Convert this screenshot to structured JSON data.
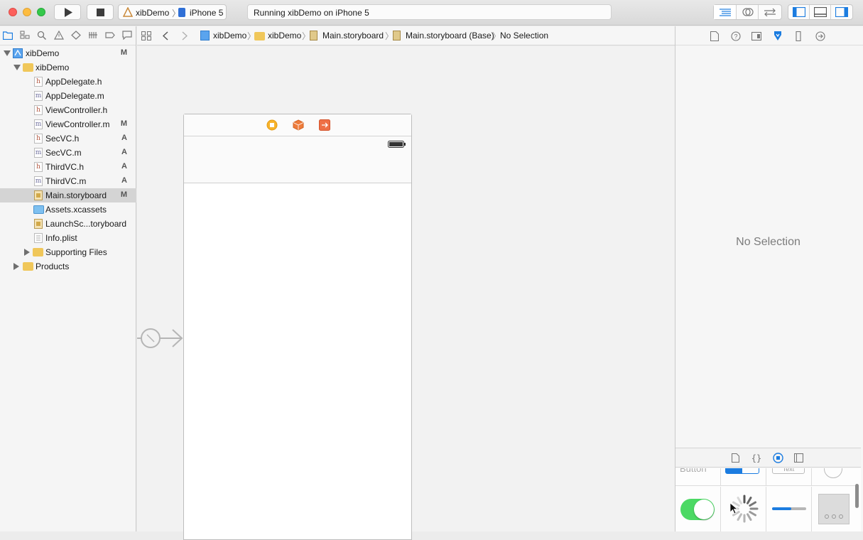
{
  "toolbar": {
    "scheme_project": "xibDemo",
    "scheme_device": "iPhone 5",
    "status_text": "Running xibDemo on iPhone 5"
  },
  "navigator": {
    "items": [
      {
        "label": "xibDemo",
        "badge": "M",
        "kind": "project"
      },
      {
        "label": "xibDemo",
        "badge": "",
        "kind": "folder"
      },
      {
        "label": "AppDelegate.h",
        "badge": "",
        "kind": "h"
      },
      {
        "label": "AppDelegate.m",
        "badge": "",
        "kind": "m"
      },
      {
        "label": "ViewController.h",
        "badge": "",
        "kind": "h"
      },
      {
        "label": "ViewController.m",
        "badge": "M",
        "kind": "m"
      },
      {
        "label": "SecVC.h",
        "badge": "A",
        "kind": "h"
      },
      {
        "label": "SecVC.m",
        "badge": "A",
        "kind": "m"
      },
      {
        "label": "ThirdVC.h",
        "badge": "A",
        "kind": "h"
      },
      {
        "label": "ThirdVC.m",
        "badge": "A",
        "kind": "m"
      },
      {
        "label": "Main.storyboard",
        "badge": "M",
        "kind": "storyboard",
        "selected": true
      },
      {
        "label": "Assets.xcassets",
        "badge": "",
        "kind": "assets"
      },
      {
        "label": "LaunchSc...toryboard",
        "badge": "",
        "kind": "storyboard"
      },
      {
        "label": "Info.plist",
        "badge": "",
        "kind": "plist"
      },
      {
        "label": "Supporting Files",
        "badge": "",
        "kind": "folder"
      },
      {
        "label": "Products",
        "badge": "",
        "kind": "folder"
      }
    ],
    "file_letters": {
      "h": "h",
      "m": "m"
    }
  },
  "jumpbar": {
    "crumbs": [
      "xibDemo",
      "xibDemo",
      "Main.storyboard",
      "Main.storyboard (Base)",
      "No Selection"
    ]
  },
  "inspector": {
    "no_selection": "No Selection",
    "library_partial": {
      "button": "Button",
      "text": "Text"
    }
  },
  "colors": {
    "accent": "#1b7ce0",
    "selection": "#d4d4d4",
    "toggle_on": "#4cd964",
    "folder": "#f0c75a"
  }
}
